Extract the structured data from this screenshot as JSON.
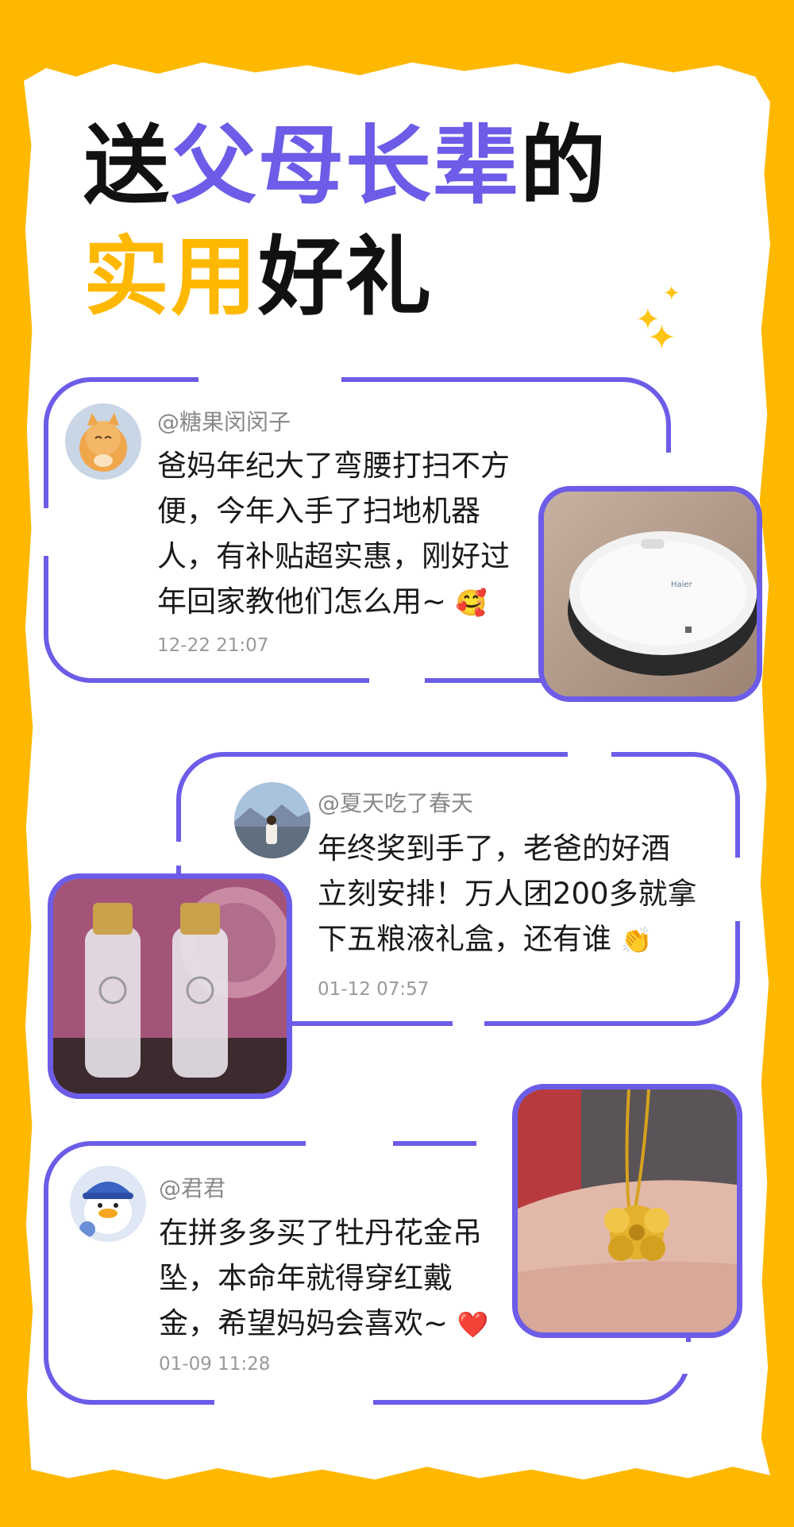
{
  "title": {
    "line1": [
      {
        "text": "送",
        "color": "black"
      },
      {
        "text": "父母长辈",
        "color": "purple"
      },
      {
        "text": "的",
        "color": "black"
      }
    ],
    "line2": [
      {
        "text": "实用",
        "color": "yellow"
      },
      {
        "text": "好礼",
        "color": "black"
      }
    ]
  },
  "sparkle": "✦",
  "posts": [
    {
      "username": "@糖果闵闵子",
      "comment": "爸妈年纪大了弯腰打扫不方便，今年入手了扫地机器人，有补贴超实惠，刚好过年回家教他们怎么用~",
      "emoji": "🥰",
      "time": "12-22  21:07",
      "photo_brand": "Haier",
      "avatar_icon": "cat-avatar-icon"
    },
    {
      "username": "@夏天吃了春天",
      "comment": "年终奖到手了，老爸的好酒立刻安排！万人团200多就拿下五粮液礼盒，还有谁",
      "emoji": "👏",
      "time": "01-12  07:57",
      "avatar_icon": "landscape-avatar-icon"
    },
    {
      "username": "@君君",
      "comment": "在拼多多买了牡丹花金吊坠，本命年就得穿红戴金，希望妈妈会喜欢~",
      "emoji": "❤️",
      "time": "01-09  11:28",
      "avatar_icon": "duck-avatar-icon"
    }
  ],
  "colors": {
    "accent": "#6C5CE7",
    "background": "#FFB800",
    "highlight": "#FFB800"
  }
}
